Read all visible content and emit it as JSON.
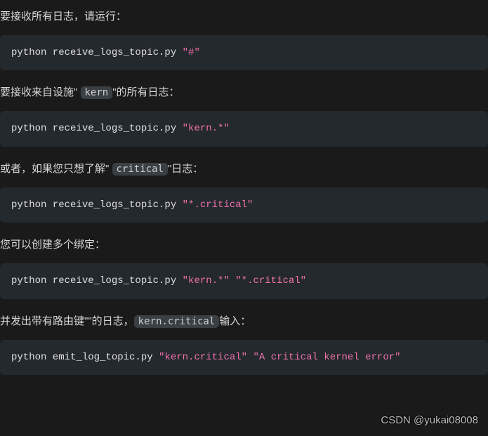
{
  "sections": [
    {
      "text_before": "要接收所有日志，请运行：",
      "inline": null,
      "text_after": "",
      "code": {
        "cmd": "python receive_logs_topic.py ",
        "args": [
          "\"#\""
        ]
      }
    },
    {
      "text_before": "要接收来自设施\" ",
      "inline": "kern",
      "text_after": "\"的所有日志：",
      "code": {
        "cmd": "python receive_logs_topic.py ",
        "args": [
          "\"kern.*\""
        ]
      }
    },
    {
      "text_before": "或者，如果您只想了解\" ",
      "inline": "critical",
      "text_after": "\"日志：",
      "code": {
        "cmd": "python receive_logs_topic.py ",
        "args": [
          "\"*.critical\""
        ]
      }
    },
    {
      "text_before": "您可以创建多个绑定：",
      "inline": null,
      "text_after": "",
      "code": {
        "cmd": "python receive_logs_topic.py ",
        "args": [
          "\"kern.*\"",
          "\"*.critical\""
        ]
      }
    },
    {
      "text_before": "并发出带有路由键\"\"的日志，",
      "inline": "kern.critical",
      "text_after": "输入：",
      "code": {
        "cmd": "python emit_log_topic.py ",
        "args": [
          "\"kern.critical\"",
          "\"A critical kernel error\""
        ]
      }
    }
  ],
  "watermark": "CSDN @yukai08008"
}
